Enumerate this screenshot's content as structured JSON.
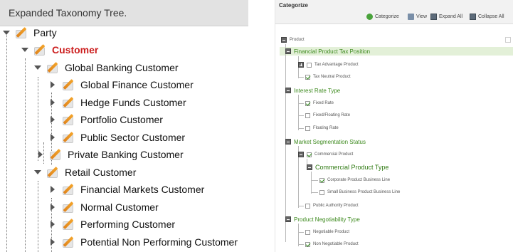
{
  "left": {
    "header": "Expanded Taxonomy Tree.",
    "nodes": [
      {
        "label": "Party",
        "toggle": "down",
        "selected": false
      },
      {
        "label": "Customer",
        "toggle": "down",
        "selected": true
      },
      {
        "label": "Global Banking Customer",
        "toggle": "down",
        "selected": false
      },
      {
        "label": "Global Finance Customer",
        "toggle": "right",
        "selected": false
      },
      {
        "label": "Hedge Funds Customer",
        "toggle": "right",
        "selected": false
      },
      {
        "label": "Portfolio Customer",
        "toggle": "right",
        "selected": false
      },
      {
        "label": "Public Sector Customer",
        "toggle": "right",
        "selected": false
      },
      {
        "label": "Private Banking Customer",
        "toggle": "right",
        "selected": false
      },
      {
        "label": "Retail Customer",
        "toggle": "down",
        "selected": false
      },
      {
        "label": "Financial Markets Customer",
        "toggle": "right",
        "selected": false
      },
      {
        "label": "Normal Customer",
        "toggle": "right",
        "selected": false
      },
      {
        "label": "Performing Customer",
        "toggle": "right",
        "selected": false
      },
      {
        "label": "Potential Non Performing Customer",
        "toggle": "right",
        "selected": false
      }
    ]
  },
  "right": {
    "title": "Categorize",
    "toolbar": {
      "categorize": "Categorize",
      "view": "View",
      "expand_all": "Expand All",
      "collapse_all": "Collapse All"
    },
    "rows": [
      {
        "label": "Product",
        "kind": "root",
        "checked": false
      },
      {
        "label": "Financial Product Tax Position",
        "kind": "group",
        "checked": false
      },
      {
        "label": "Tax Advantage Product",
        "kind": "item-plus",
        "checked": false
      },
      {
        "label": "Tax Neutral Product",
        "kind": "item",
        "checked": true
      },
      {
        "label": "Interest Rate Type",
        "kind": "group",
        "checked": false
      },
      {
        "label": "Fixed Rate",
        "kind": "item",
        "checked": true
      },
      {
        "label": "Fixed/Floating Rate",
        "kind": "item",
        "checked": false
      },
      {
        "label": "Floating Rate",
        "kind": "item",
        "checked": false
      },
      {
        "label": "Market Segmentation Status",
        "kind": "group",
        "checked": false
      },
      {
        "label": "Commercial Product",
        "kind": "item-minus",
        "checked": true
      },
      {
        "label": "Commercial Product Type",
        "kind": "subgroup",
        "checked": false
      },
      {
        "label": "Corporate Product Business Line",
        "kind": "subitem",
        "checked": true
      },
      {
        "label": "Small Business Product Business Line",
        "kind": "subitem",
        "checked": false
      },
      {
        "label": "Public Authority Product",
        "kind": "item",
        "checked": false
      },
      {
        "label": "Product Negotiability Type",
        "kind": "group",
        "checked": false
      },
      {
        "label": "Negotiable Product",
        "kind": "item",
        "checked": false
      },
      {
        "label": "Non Negotiable Product",
        "kind": "item",
        "checked": true
      }
    ],
    "colors": {
      "accent_green": "#3d8a1e",
      "band": "#e3f0d8",
      "selected_red": "#cc1f1f"
    }
  }
}
